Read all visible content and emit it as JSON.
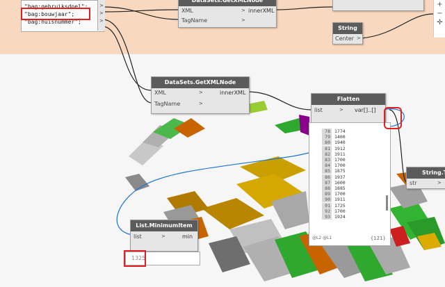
{
  "code_block": {
    "lines": [
      "\"bag:gebruiksdoel\";",
      "\"bag:bouwjaar\";",
      "\"bag:huisnummer\";"
    ]
  },
  "node_top_getxml": {
    "title": "DataSets.GetXMLNode",
    "in_xml": "XML",
    "in_tagname": "TagName",
    "out": "innerXML"
  },
  "node_string": {
    "title": "String",
    "in": "Center",
    "out": ">"
  },
  "node_getxml": {
    "title": "DataSets.GetXMLNode",
    "in_xml": "XML",
    "in_tagname": "TagName",
    "out": "innerXML"
  },
  "node_flatten": {
    "title": "Flatten",
    "in": "list",
    "out": "var[]..[]"
  },
  "node_stringto": {
    "title": "String.To",
    "in": "str"
  },
  "node_minitem": {
    "title": "List.MinimumItem",
    "in": "list",
    "out": "min"
  },
  "watch_value": "1325",
  "list_preview": {
    "rows": [
      {
        "i": "78",
        "v": "1774"
      },
      {
        "i": "79",
        "v": "1400"
      },
      {
        "i": "80",
        "v": "1940"
      },
      {
        "i": "81",
        "v": "1912"
      },
      {
        "i": "82",
        "v": "1911"
      },
      {
        "i": "83",
        "v": "1700"
      },
      {
        "i": "84",
        "v": "1700"
      },
      {
        "i": "85",
        "v": "1875"
      },
      {
        "i": "86",
        "v": "1937"
      },
      {
        "i": "87",
        "v": "1600"
      },
      {
        "i": "88",
        "v": "1885"
      },
      {
        "i": "89",
        "v": "1700"
      },
      {
        "i": "90",
        "v": "1911"
      },
      {
        "i": "91",
        "v": "1725"
      },
      {
        "i": "92",
        "v": "1700"
      },
      {
        "i": "93",
        "v": "1924"
      }
    ],
    "footer_left": "@L2 @L1",
    "footer_right": "{121}"
  },
  "toolbar": {
    "icons": [
      "plus-icon",
      "minus-icon",
      "fit-icon"
    ]
  },
  "colors": {
    "wire": "#1e74d0",
    "node_header": "#5b5b5b",
    "highlight": "#e02020"
  }
}
